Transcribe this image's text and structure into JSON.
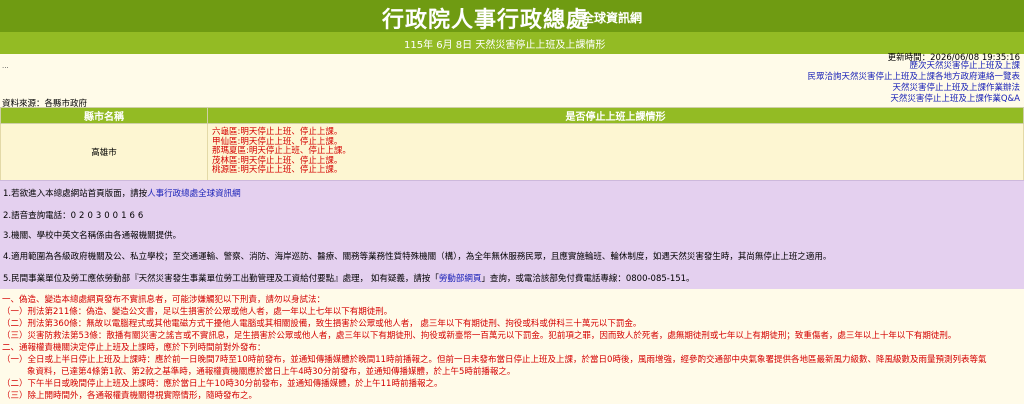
{
  "header": {
    "title": "行政院人事行政總處",
    "subtitle": "全球資訊網",
    "date_line": "115年 6月 8日 天然災害停止上班及上課情形"
  },
  "update_time": "更新時間：2026/06/08 19:35:16",
  "top_links": [
    "歷次天然災害停止上班及上課",
    "民眾洽詢天然災害停止上班及上課各地方政府連絡一覽表",
    "天然災害停止上班及上課作業辦法",
    "天然災害停止上班及上課作業Q&A"
  ],
  "dots": "...",
  "data_source": "資料來源：各縣市政府",
  "table": {
    "headers": [
      "縣市名稱",
      "是否停止上班上課情形"
    ],
    "county": "高雄市",
    "status_lines": [
      "六龜區:明天停止上班、停止上課。",
      "甲仙區:明天停止上班、停止上課。",
      "那瑪夏區:明天停止上班、停止上課。",
      "茂林區:明天停止上班、停止上課。",
      "桃源區:明天停止上班、停止上課。"
    ]
  },
  "notes": {
    "n1_pre": "1.若欲進入本總處網站首頁版面，請按",
    "n1_link": "人事行政總處全球資訊網",
    "n2_pre": "2.語音查詢電話：",
    "n2_phone": "020300166",
    "n3": "3.機關、學校中英文名稱係由各通報機關提供。",
    "n4": "4.適用範圍為各級政府機關及公、私立學校；至交通運輸、警察、消防、海岸巡防、醫療、關務等業務性質特殊機關（構），為全年無休服務民眾，且應實施輪班、輪休制度，如遇天然災害發生時，其尚無停止上班之適用。",
    "n5_pre": "5.民間事業單位及勞工應依勞動部『天然災害發生事業單位勞工出勤管理及工資給付要點』處理， 如有疑義，請按「",
    "n5_link": "勞動部網頁",
    "n5_post": "」查詢，或電洽該部免付費電話專線：0800-085-151。"
  },
  "warnings": [
    "一、偽造、變造本總處網頁發布不實訊息者，可能涉嫌觸犯以下刑責，請勿以身試法：",
    "（一）刑法第211條：偽造、變造公文書，足以生損害於公眾或他人者，處一年以上七年以下有期徒刑。",
    "（二）刑法第360條：無故以電腦程式或其他電磁方式干擾他人電腦或其相關設備，致生損害於公眾或他人者， 處三年以下有期徒刑、拘役或科或併科三十萬元以下罰金。",
    "（三）災害防救法第53條：散播有關災害之謠言或不實訊息，足生損害於公眾或他人者，處三年以下有期徒刑、拘役或新臺幣一百萬元以下罰金。犯前項之罪，因而致人於死者，處無期徒刑或七年以上有期徒刑；致重傷者，處三年以上十年以下有期徒刑。",
    "二、通報權責機關決定停止上班及上課時，應於下列時間前對外發布：",
    "（一）全日或上半日停止上班及上課時：應於前一日晚間7時至10時前發布，並通知傳播媒體於晚間11時前播報之。但前一日未發布當日停止上班及上課，於當日0時後，風雨增強，經參酌交通部中央氣象署提供各地區最新風力級數、降風級數及雨量預測列表等氣",
    "象資料，已達第4條第1款、第2款之基準時，通報權責機關應於當日上午4時30分前發布，並通知傳播媒體，於上午5時前播報之。",
    "（二）下午半日或晚間停止上班及上課時：應於當日上午10時30分前發布，並通知傳播媒體，於上午11時前播報之。",
    "（三）除上開時間外，各通報權責機關得視實際情形，隨時發布之。"
  ]
}
